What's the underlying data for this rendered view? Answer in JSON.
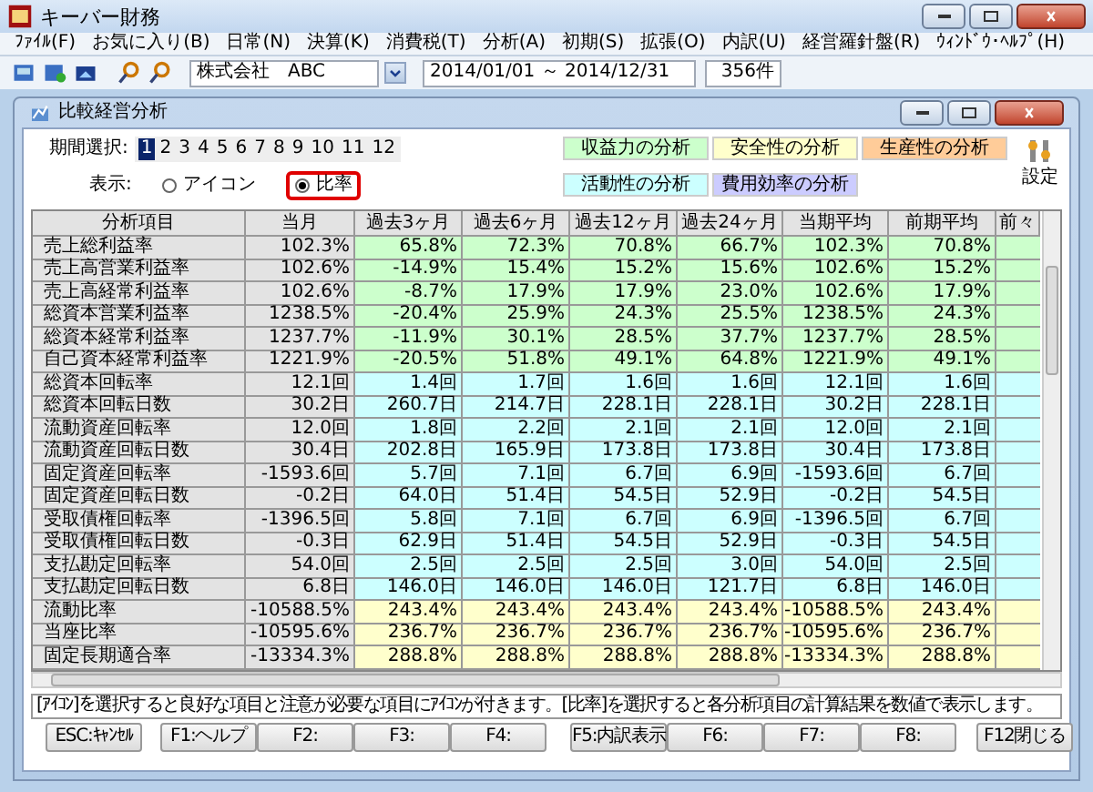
{
  "window": {
    "title": "キーバー財務"
  },
  "menu": [
    "ﾌｧｲﾙ(F)",
    "お気に入り(B)",
    "日常(N)",
    "決算(K)",
    "消費税(T)",
    "分析(A)",
    "初期(S)",
    "拡張(O)",
    "内訳(U)",
    "経営羅針盤(R)",
    "ｳｨﾝﾄﾞｳ･ﾍﾙﾌﾟ(H)"
  ],
  "toolbar": {
    "company": "株式会社　ABC",
    "period": "2014/01/01 ～ 2014/12/31",
    "count": "356件"
  },
  "inner_window": {
    "title": "比較経営分析"
  },
  "period_select": {
    "label": "期間選択:",
    "periods": [
      {
        "label": "1",
        "selected": true
      },
      {
        "label": "2",
        "selected": false
      },
      {
        "label": "3",
        "selected": false
      },
      {
        "label": "4",
        "selected": false
      },
      {
        "label": "5",
        "selected": false
      },
      {
        "label": "6",
        "selected": false
      },
      {
        "label": "7",
        "selected": false
      },
      {
        "label": "8",
        "selected": false
      },
      {
        "label": "9",
        "selected": false
      },
      {
        "label": "10",
        "selected": false
      },
      {
        "label": "11",
        "selected": false
      },
      {
        "label": "12",
        "selected": false
      }
    ]
  },
  "display": {
    "label": "表示:",
    "options": [
      {
        "label": "アイコン",
        "selected": false
      },
      {
        "label": "比率",
        "selected": true
      }
    ]
  },
  "analysis_buttons": [
    {
      "label": "収益力の分析",
      "color": "#ccffcc"
    },
    {
      "label": "安全性の分析",
      "color": "#ffffcc"
    },
    {
      "label": "生産性の分析",
      "color": "#ffcc99"
    },
    {
      "label": "活動性の分析",
      "color": "#ccffff"
    },
    {
      "label": "費用効率の分析",
      "color": "#ccccff"
    }
  ],
  "settings": {
    "label": "設定"
  },
  "table": {
    "columns": [
      "分析項目",
      "当月",
      "過去3ヶ月",
      "過去6ヶ月",
      "過去12ヶ月",
      "過去24ヶ月",
      "当期平均",
      "前期平均",
      "前々"
    ],
    "rows": [
      {
        "kind": "profitability",
        "item": "売上総利益率",
        "values": [
          "102.3%",
          "65.8%",
          "72.3%",
          "70.8%",
          "66.7%",
          "102.3%",
          "70.8%"
        ]
      },
      {
        "kind": "profitability",
        "item": "売上高営業利益率",
        "values": [
          "102.6%",
          "-14.9%",
          "15.4%",
          "15.2%",
          "15.6%",
          "102.6%",
          "15.2%"
        ]
      },
      {
        "kind": "profitability",
        "item": "売上高経常利益率",
        "values": [
          "102.6%",
          "-8.7%",
          "17.9%",
          "17.9%",
          "23.0%",
          "102.6%",
          "17.9%"
        ]
      },
      {
        "kind": "profitability",
        "item": "総資本営業利益率",
        "values": [
          "1238.5%",
          "-20.4%",
          "25.9%",
          "24.3%",
          "25.5%",
          "1238.5%",
          "24.3%"
        ]
      },
      {
        "kind": "profitability",
        "item": "総資本経常利益率",
        "values": [
          "1237.7%",
          "-11.9%",
          "30.1%",
          "28.5%",
          "37.7%",
          "1237.7%",
          "28.5%"
        ]
      },
      {
        "kind": "profitability",
        "item": "自己資本経常利益率",
        "values": [
          "1221.9%",
          "-20.5%",
          "51.8%",
          "49.1%",
          "64.8%",
          "1221.9%",
          "49.1%"
        ]
      },
      {
        "kind": "activity",
        "item": "総資本回転率",
        "values": [
          "12.1回",
          "1.4回",
          "1.7回",
          "1.6回",
          "1.6回",
          "12.1回",
          "1.6回"
        ]
      },
      {
        "kind": "activity",
        "item": "総資本回転日数",
        "values": [
          "30.2日",
          "260.7日",
          "214.7日",
          "228.1日",
          "228.1日",
          "30.2日",
          "228.1日"
        ]
      },
      {
        "kind": "activity",
        "item": "流動資産回転率",
        "values": [
          "12.0回",
          "1.8回",
          "2.2回",
          "2.1回",
          "2.1回",
          "12.0回",
          "2.1回"
        ]
      },
      {
        "kind": "activity",
        "item": "流動資産回転日数",
        "values": [
          "30.4日",
          "202.8日",
          "165.9日",
          "173.8日",
          "173.8日",
          "30.4日",
          "173.8日"
        ]
      },
      {
        "kind": "activity",
        "item": "固定資産回転率",
        "values": [
          "-1593.6回",
          "5.7回",
          "7.1回",
          "6.7回",
          "6.9回",
          "-1593.6回",
          "6.7回"
        ]
      },
      {
        "kind": "activity",
        "item": "固定資産回転日数",
        "values": [
          "-0.2日",
          "64.0日",
          "51.4日",
          "54.5日",
          "52.9日",
          "-0.2日",
          "54.5日"
        ]
      },
      {
        "kind": "activity",
        "item": "受取債権回転率",
        "values": [
          "-1396.5回",
          "5.8回",
          "7.1回",
          "6.7回",
          "6.9回",
          "-1396.5回",
          "6.7回"
        ]
      },
      {
        "kind": "activity",
        "item": "受取債権回転日数",
        "values": [
          "-0.3日",
          "62.9日",
          "51.4日",
          "54.5日",
          "52.9日",
          "-0.3日",
          "54.5日"
        ]
      },
      {
        "kind": "activity",
        "item": "支払勘定回転率",
        "values": [
          "54.0回",
          "2.5回",
          "2.5回",
          "2.5回",
          "3.0回",
          "54.0回",
          "2.5回"
        ]
      },
      {
        "kind": "activity",
        "item": "支払勘定回転日数",
        "values": [
          "6.8日",
          "146.0日",
          "146.0日",
          "146.0日",
          "121.7日",
          "6.8日",
          "146.0日"
        ]
      },
      {
        "kind": "safety",
        "item": "流動比率",
        "values": [
          "-10588.5%",
          "243.4%",
          "243.4%",
          "243.4%",
          "243.4%",
          "-10588.5%",
          "243.4%"
        ]
      },
      {
        "kind": "safety",
        "item": "当座比率",
        "values": [
          "-10595.6%",
          "236.7%",
          "236.7%",
          "236.7%",
          "236.7%",
          "-10595.6%",
          "236.7%"
        ]
      },
      {
        "kind": "safety",
        "item": "固定長期適合率",
        "values": [
          "-13334.3%",
          "288.8%",
          "288.8%",
          "288.8%",
          "288.8%",
          "-13334.3%",
          "288.8%"
        ]
      }
    ]
  },
  "message": "[ｱｲｺﾝ]を選択すると良好な項目と注意が必要な項目にｱｲｺﾝが付きます。[比率]を選択すると各分析項目の計算結果を数値で表示します。",
  "function_keys": [
    "ESC:ｷｬﾝｾﾙ",
    "F1:ヘルプ",
    "F2:",
    "F3:",
    "F4:",
    "F5:内訳表示",
    "F6:",
    "F7:",
    "F8:",
    "F12閉じる"
  ]
}
